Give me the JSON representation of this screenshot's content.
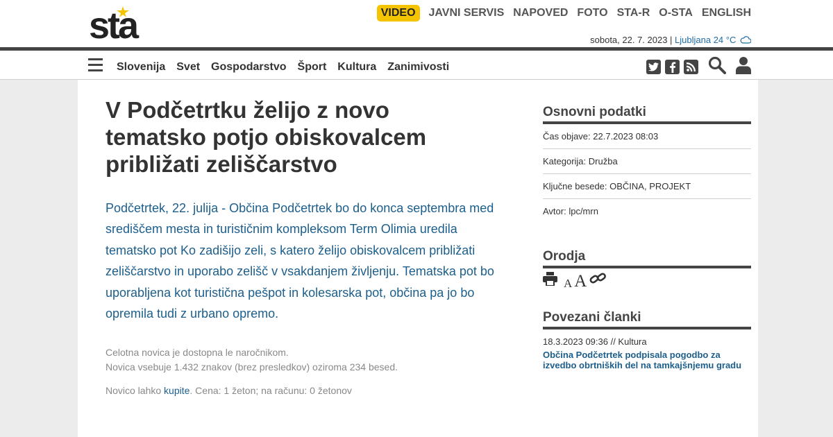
{
  "logo": {
    "text": "sta",
    "star_color": "#f5c400"
  },
  "top_nav": {
    "items": [
      "VIDEO",
      "JAVNI SERVIS",
      "NAPOVED",
      "FOTO",
      "STA-R",
      "O-STA",
      "ENGLISH"
    ],
    "highlight_color": "#f5c400"
  },
  "dateline": {
    "date": "sobota, 22. 7. 2023",
    "separator": " | ",
    "weather": "Ljubljana 24 °C",
    "weather_icon": "cloud-icon"
  },
  "main_nav": {
    "items": [
      "Slovenija",
      "Svet",
      "Gospodarstvo",
      "Šport",
      "Kultura",
      "Zanimivosti"
    ],
    "icons": [
      "twitter-icon",
      "facebook-icon",
      "rss-icon",
      "search-icon",
      "user-icon"
    ]
  },
  "article": {
    "title": "V Podčetrtku želijo z novo tematsko potjo obiskovalcem približati zeliščarstvo",
    "lead": "Podčetrtek, 22. julija - Občina Podčetrtek bo do konca septembra med središčem mesta in turističnim kompleksom Term Olimia uredila tematsko pot Ko zadišijo zeli, s katero želijo obiskovalcem približati zeliščarstvo in uporabo zelišč v vsakdanjem življenju. Tematska pot bo uporabljena kot turistična peš­pot in kolesarska pot, občina pa jo bo opremila tudi z urbano opremo.",
    "note_1": "Celotna novica je dostopna le naročnikom.",
    "note_2": "Novica vsebuje 1.432 znakov (brez presledkov) oziroma 234 besed.",
    "buy_prefix": "Novico lahko ",
    "buy_link": "kupite",
    "buy_suffix": ". Cena: 1 žeton; na računu: 0 žetonov"
  },
  "sidebar": {
    "basic_title": "Osnovni podatki",
    "published": "Čas objave: 22.7.2023 08:03",
    "category": "Kategorija: Družba",
    "keywords": "Ključne besede: OBČINA, PROJEKT",
    "author": "Avtor: lpc/mrn",
    "tools_title": "Orodja",
    "tools_icons": [
      "print-icon",
      "font-smaller-icon",
      "font-larger-icon",
      "link-icon"
    ],
    "font_small": "A",
    "font_large": "A",
    "related_title": "Povezani članki",
    "related": [
      {
        "meta": "18.3.2023 09:36 // Kultura",
        "title": "Občina Podčetrtek podpisala pogodbo za izvedbo obrtniških del na tamkajšnjemu gradu"
      }
    ]
  },
  "colors": {
    "accent": "#1c5e8c",
    "dark": "#444444",
    "yellow": "#f5c400"
  }
}
